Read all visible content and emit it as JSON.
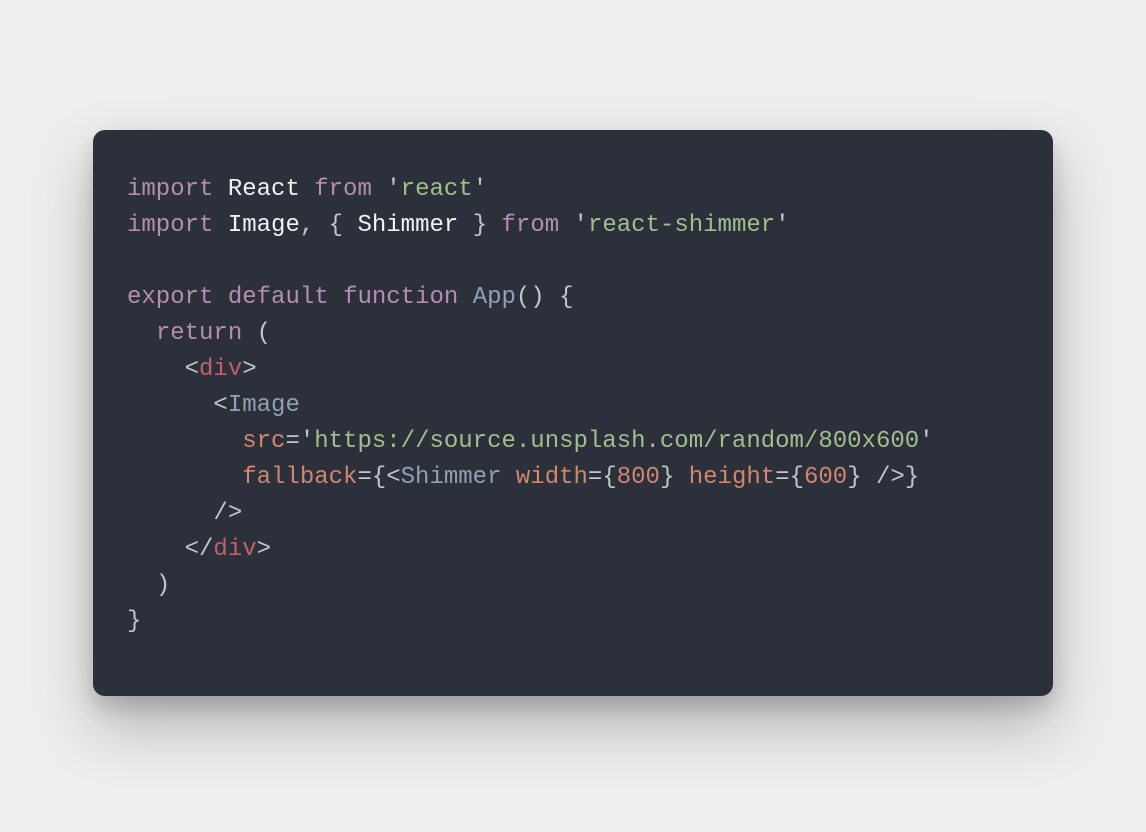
{
  "colors": {
    "background": "#eeeeee",
    "card": "#2b303b",
    "text": "#c0c5ce",
    "keyword": "#b48ead",
    "identifier": "#8fa1b3",
    "string": "#a3be8c",
    "tag": "#bf616a",
    "attr": "#d08770",
    "number": "#d08770"
  },
  "code": {
    "line1": {
      "kw1": "import",
      "id1": "React",
      "kw2": "from",
      "q1": "'",
      "str1": "react",
      "q2": "'"
    },
    "line2": {
      "kw1": "import",
      "id1": "Image",
      "comma": ",",
      "lbrace": "{",
      "id2": "Shimmer",
      "rbrace": "}",
      "kw2": "from",
      "q1": "'",
      "str1": "react-shimmer",
      "q2": "'"
    },
    "line4": {
      "kw1": "export",
      "kw2": "default",
      "kw3": "function",
      "fn": "App",
      "parens": "()",
      "lbrace": "{"
    },
    "line5": {
      "indent": "  ",
      "kw1": "return",
      "lparen": "("
    },
    "line6": {
      "indent": "    ",
      "open": "<",
      "tag": "div",
      "close": ">"
    },
    "line7": {
      "indent": "      ",
      "open": "<",
      "tag": "Image"
    },
    "line8": {
      "indent": "        ",
      "attr": "src",
      "eq": "=",
      "q1": "'",
      "str": "https://source.unsplash.com/random/800x600",
      "q2": "'"
    },
    "line9": {
      "indent": "        ",
      "attr": "fallback",
      "eq": "=",
      "lbrace": "{",
      "lt": "<",
      "tag": "Shimmer",
      "sp": " ",
      "attr2": "width",
      "eq2": "=",
      "lb2": "{",
      "num1": "800",
      "rb2": "}",
      "sp2": " ",
      "attr3": "height",
      "eq3": "=",
      "lb3": "{",
      "num2": "600",
      "rb3": "}",
      "sp3": " ",
      "slashgt": "/>",
      "rbrace": "}"
    },
    "line10": {
      "indent": "      ",
      "selfclose": "/>"
    },
    "line11": {
      "indent": "    ",
      "open": "</",
      "tag": "div",
      "close": ">"
    },
    "line12": {
      "indent": "  ",
      "rparen": ")"
    },
    "line13": {
      "rbrace": "}"
    }
  }
}
